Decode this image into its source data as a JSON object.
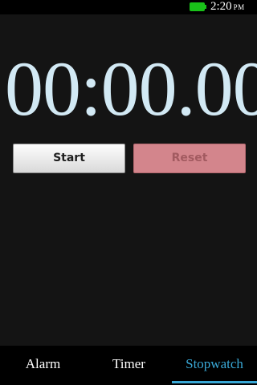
{
  "status_bar": {
    "time": "2:20",
    "ampm": "PM",
    "battery_icon": "battery-icon",
    "battery_color": "#19c119"
  },
  "stopwatch": {
    "display": "00:00.00",
    "start_label": "Start",
    "reset_label": "Reset"
  },
  "tabs": [
    {
      "label": "Alarm",
      "active": false
    },
    {
      "label": "Timer",
      "active": false
    },
    {
      "label": "Stopwatch",
      "active": true
    }
  ],
  "colors": {
    "accent": "#39a8d6",
    "display_text": "#d2e9f4",
    "reset_button": "#d3858c",
    "background": "#141414"
  }
}
